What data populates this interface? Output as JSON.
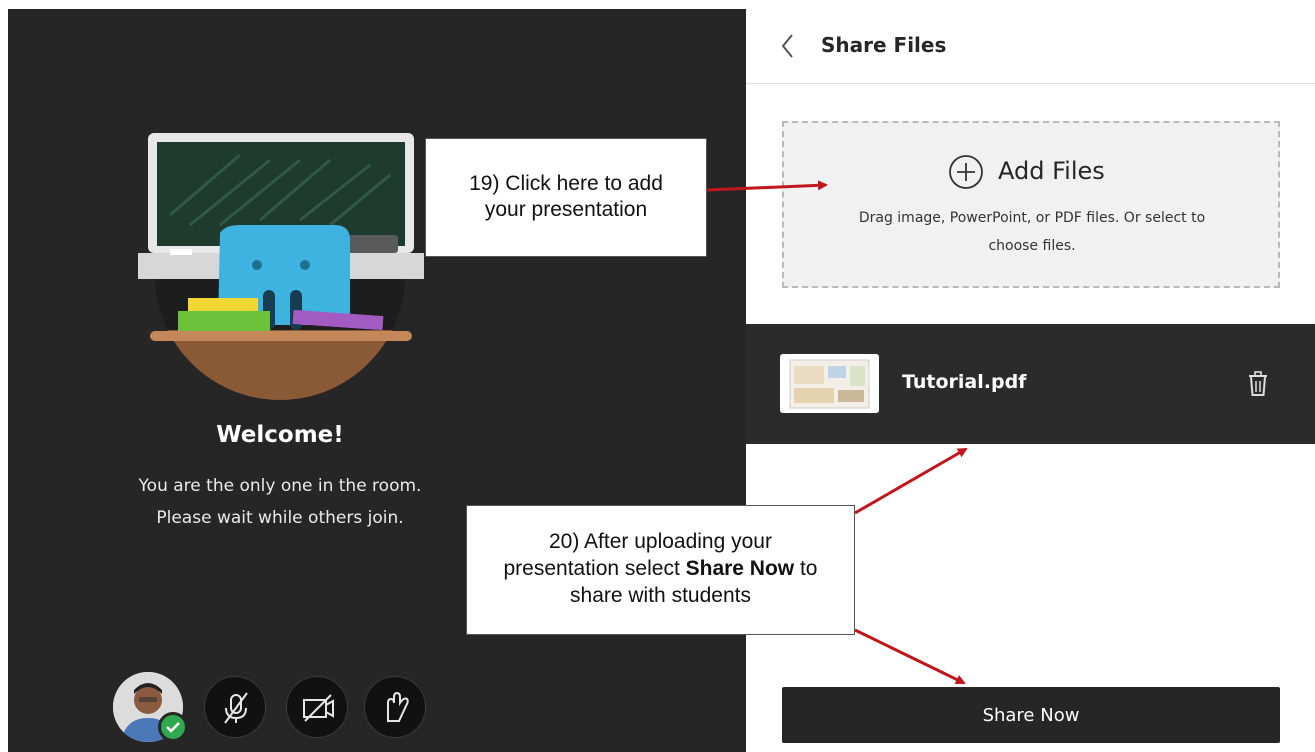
{
  "stage": {
    "welcome_title": "Welcome!",
    "welcome_line1": "You are the only one in the room.",
    "welcome_line2": "Please wait while others join."
  },
  "controls": [
    {
      "icon": "microphone-muted-icon"
    },
    {
      "icon": "camera-off-icon"
    },
    {
      "icon": "raise-hand-icon"
    }
  ],
  "panel": {
    "title": "Share Files",
    "add_files_label": "Add Files",
    "drop_hint_line1": "Drag image, PowerPoint, or PDF files. Or select to",
    "drop_hint_line2": "choose files.",
    "file_name": "Tutorial.pdf",
    "share_button_label": "Share Now"
  },
  "callouts": {
    "c1_line1": "19) Click here to add",
    "c1_line2": "your presentation",
    "c2_line1": "20) After uploading your",
    "c2_line2_pre": "presentation select ",
    "c2_line2_bold": "Share Now",
    "c2_line2_post": " to",
    "c2_line3": "share with students"
  },
  "colors": {
    "stage_bg": "#262626",
    "accent_red": "#c0161c",
    "status_green": "#2fa84f"
  }
}
